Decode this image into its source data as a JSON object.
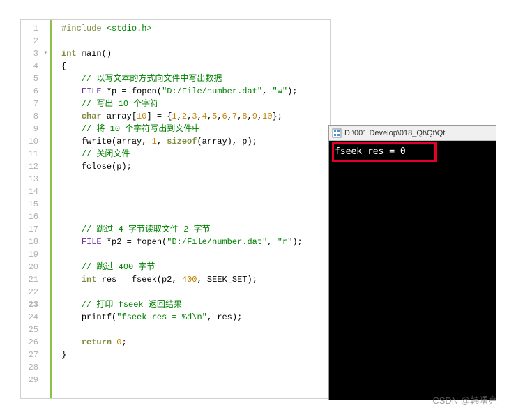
{
  "editor": {
    "lines": [
      {
        "n": 1,
        "fold": "",
        "tokens": [
          {
            "c": "pp",
            "t": "#include"
          },
          {
            "c": "op",
            "t": " "
          },
          {
            "c": "str",
            "t": "<stdio.h>"
          }
        ]
      },
      {
        "n": 2,
        "fold": "",
        "tokens": []
      },
      {
        "n": 3,
        "fold": "▾",
        "tokens": [
          {
            "c": "kw",
            "t": "int"
          },
          {
            "c": "op",
            "t": " "
          },
          {
            "c": "fn",
            "t": "main"
          },
          {
            "c": "op",
            "t": "()"
          }
        ]
      },
      {
        "n": 4,
        "fold": "",
        "tokens": [
          {
            "c": "op",
            "t": "{"
          }
        ]
      },
      {
        "n": 5,
        "fold": "",
        "tokens": [
          {
            "c": "op",
            "t": "    "
          },
          {
            "c": "cm",
            "t": "// 以写文本的方式向文件中写出数据"
          }
        ]
      },
      {
        "n": 6,
        "fold": "",
        "tokens": [
          {
            "c": "op",
            "t": "    "
          },
          {
            "c": "ty",
            "t": "FILE"
          },
          {
            "c": "op",
            "t": " *p = "
          },
          {
            "c": "fn",
            "t": "fopen"
          },
          {
            "c": "op",
            "t": "("
          },
          {
            "c": "str",
            "t": "\"D:/File/number.dat\""
          },
          {
            "c": "op",
            "t": ", "
          },
          {
            "c": "str",
            "t": "\"w\""
          },
          {
            "c": "op",
            "t": ");"
          }
        ]
      },
      {
        "n": 7,
        "fold": "",
        "tokens": [
          {
            "c": "op",
            "t": "    "
          },
          {
            "c": "cm",
            "t": "// 写出 10 个字符"
          }
        ]
      },
      {
        "n": 8,
        "fold": "",
        "tokens": [
          {
            "c": "op",
            "t": "    "
          },
          {
            "c": "kw",
            "t": "char"
          },
          {
            "c": "op",
            "t": " array["
          },
          {
            "c": "num",
            "t": "10"
          },
          {
            "c": "op",
            "t": "] = {"
          },
          {
            "c": "num",
            "t": "1"
          },
          {
            "c": "op",
            "t": ","
          },
          {
            "c": "num",
            "t": "2"
          },
          {
            "c": "op",
            "t": ","
          },
          {
            "c": "num",
            "t": "3"
          },
          {
            "c": "op",
            "t": ","
          },
          {
            "c": "num",
            "t": "4"
          },
          {
            "c": "op",
            "t": ","
          },
          {
            "c": "num",
            "t": "5"
          },
          {
            "c": "op",
            "t": ","
          },
          {
            "c": "num",
            "t": "6"
          },
          {
            "c": "op",
            "t": ","
          },
          {
            "c": "num",
            "t": "7"
          },
          {
            "c": "op",
            "t": ","
          },
          {
            "c": "num",
            "t": "8"
          },
          {
            "c": "op",
            "t": ","
          },
          {
            "c": "num",
            "t": "9"
          },
          {
            "c": "op",
            "t": ","
          },
          {
            "c": "num",
            "t": "10"
          },
          {
            "c": "op",
            "t": "};"
          }
        ]
      },
      {
        "n": 9,
        "fold": "",
        "tokens": [
          {
            "c": "op",
            "t": "    "
          },
          {
            "c": "cm",
            "t": "// 将 10 个字符写出到文件中"
          }
        ]
      },
      {
        "n": 10,
        "fold": "",
        "tokens": [
          {
            "c": "op",
            "t": "    "
          },
          {
            "c": "fn",
            "t": "fwrite"
          },
          {
            "c": "op",
            "t": "(array, "
          },
          {
            "c": "num",
            "t": "1"
          },
          {
            "c": "op",
            "t": ", "
          },
          {
            "c": "kw",
            "t": "sizeof"
          },
          {
            "c": "op",
            "t": "(array), p);"
          }
        ]
      },
      {
        "n": 11,
        "fold": "",
        "tokens": [
          {
            "c": "op",
            "t": "    "
          },
          {
            "c": "cm",
            "t": "// 关闭文件"
          }
        ]
      },
      {
        "n": 12,
        "fold": "",
        "tokens": [
          {
            "c": "op",
            "t": "    "
          },
          {
            "c": "fn",
            "t": "fclose"
          },
          {
            "c": "op",
            "t": "(p);"
          }
        ]
      },
      {
        "n": 13,
        "fold": "",
        "tokens": []
      },
      {
        "n": 14,
        "fold": "",
        "tokens": []
      },
      {
        "n": 15,
        "fold": "",
        "tokens": []
      },
      {
        "n": 16,
        "fold": "",
        "tokens": []
      },
      {
        "n": 17,
        "fold": "",
        "tokens": [
          {
            "c": "op",
            "t": "    "
          },
          {
            "c": "cm",
            "t": "// 跳过 4 字节读取文件 2 字节"
          }
        ]
      },
      {
        "n": 18,
        "fold": "",
        "tokens": [
          {
            "c": "op",
            "t": "    "
          },
          {
            "c": "ty",
            "t": "FILE"
          },
          {
            "c": "op",
            "t": " *p2 = "
          },
          {
            "c": "fn",
            "t": "fopen"
          },
          {
            "c": "op",
            "t": "("
          },
          {
            "c": "str",
            "t": "\"D:/File/number.dat\""
          },
          {
            "c": "op",
            "t": ", "
          },
          {
            "c": "str",
            "t": "\"r\""
          },
          {
            "c": "op",
            "t": ");"
          }
        ]
      },
      {
        "n": 19,
        "fold": "",
        "tokens": []
      },
      {
        "n": 20,
        "fold": "",
        "tokens": [
          {
            "c": "op",
            "t": "    "
          },
          {
            "c": "cm",
            "t": "// 跳过 400 字节"
          }
        ]
      },
      {
        "n": 21,
        "fold": "",
        "tokens": [
          {
            "c": "op",
            "t": "    "
          },
          {
            "c": "kw",
            "t": "int"
          },
          {
            "c": "op",
            "t": " res = "
          },
          {
            "c": "fn",
            "t": "fseek"
          },
          {
            "c": "op",
            "t": "(p2, "
          },
          {
            "c": "num",
            "t": "400"
          },
          {
            "c": "op",
            "t": ", SEEK_SET);"
          }
        ]
      },
      {
        "n": 22,
        "fold": "",
        "tokens": []
      },
      {
        "n": 23,
        "fold": "",
        "tokens": [
          {
            "c": "op",
            "t": "    "
          },
          {
            "c": "cm",
            "t": "// 打印 fseek 返回结果"
          }
        ]
      },
      {
        "n": 24,
        "fold": "",
        "tokens": [
          {
            "c": "op",
            "t": "    "
          },
          {
            "c": "fn",
            "t": "printf"
          },
          {
            "c": "op",
            "t": "("
          },
          {
            "c": "str",
            "t": "\"fseek res = %d\\n\""
          },
          {
            "c": "op",
            "t": ", res);"
          }
        ]
      },
      {
        "n": 25,
        "fold": "",
        "tokens": []
      },
      {
        "n": 26,
        "fold": "",
        "tokens": [
          {
            "c": "op",
            "t": "    "
          },
          {
            "c": "kw",
            "t": "return"
          },
          {
            "c": "op",
            "t": " "
          },
          {
            "c": "num",
            "t": "0"
          },
          {
            "c": "op",
            "t": ";"
          }
        ]
      },
      {
        "n": 27,
        "fold": "",
        "tokens": [
          {
            "c": "op",
            "t": "}"
          }
        ]
      },
      {
        "n": 28,
        "fold": "",
        "tokens": []
      },
      {
        "n": 29,
        "fold": "",
        "tokens": []
      }
    ],
    "current_line": 23
  },
  "console": {
    "title": "D:\\001 Develop\\018_Qt\\Qt\\Qt",
    "output": "fseek res = 0"
  },
  "watermark": "CSDN @韩曙亮"
}
